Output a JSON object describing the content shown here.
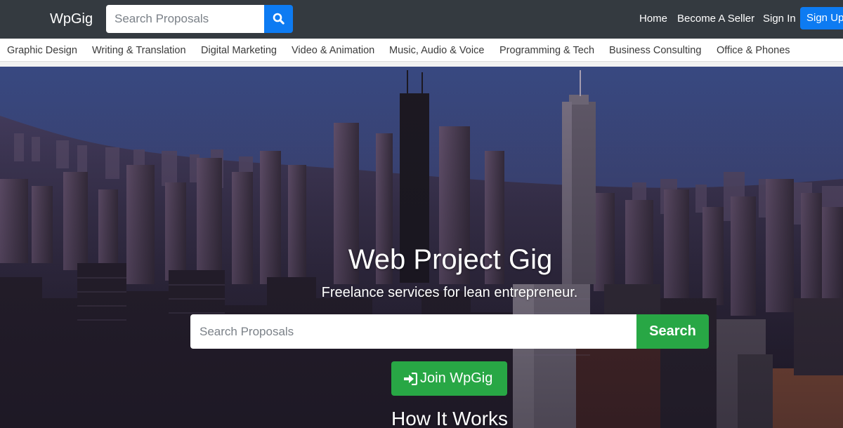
{
  "navbar": {
    "brand": "WpGig",
    "search_placeholder": "Search Proposals",
    "links": {
      "home": "Home",
      "become_seller": "Become A Seller",
      "sign_in": "Sign In",
      "sign_up": "Sign Up"
    }
  },
  "categories": [
    "Graphic Design",
    "Writing & Translation",
    "Digital Marketing",
    "Video & Animation",
    "Music, Audio & Voice",
    "Programming & Tech",
    "Business Consulting",
    "Office & Phones"
  ],
  "hero": {
    "title": "Web Project Gig",
    "subtitle": "Freelance services for lean entrepreneur.",
    "search_placeholder": "Search Proposals",
    "search_button": "Search",
    "join_button": "Join WpGig",
    "how_it_works": "How It Works"
  },
  "icons": {
    "nav_search": "search-icon",
    "join": "sign-in-icon"
  },
  "colors": {
    "navbar": "#343a40",
    "primary": "#0d7bf2",
    "success": "#28a745"
  }
}
